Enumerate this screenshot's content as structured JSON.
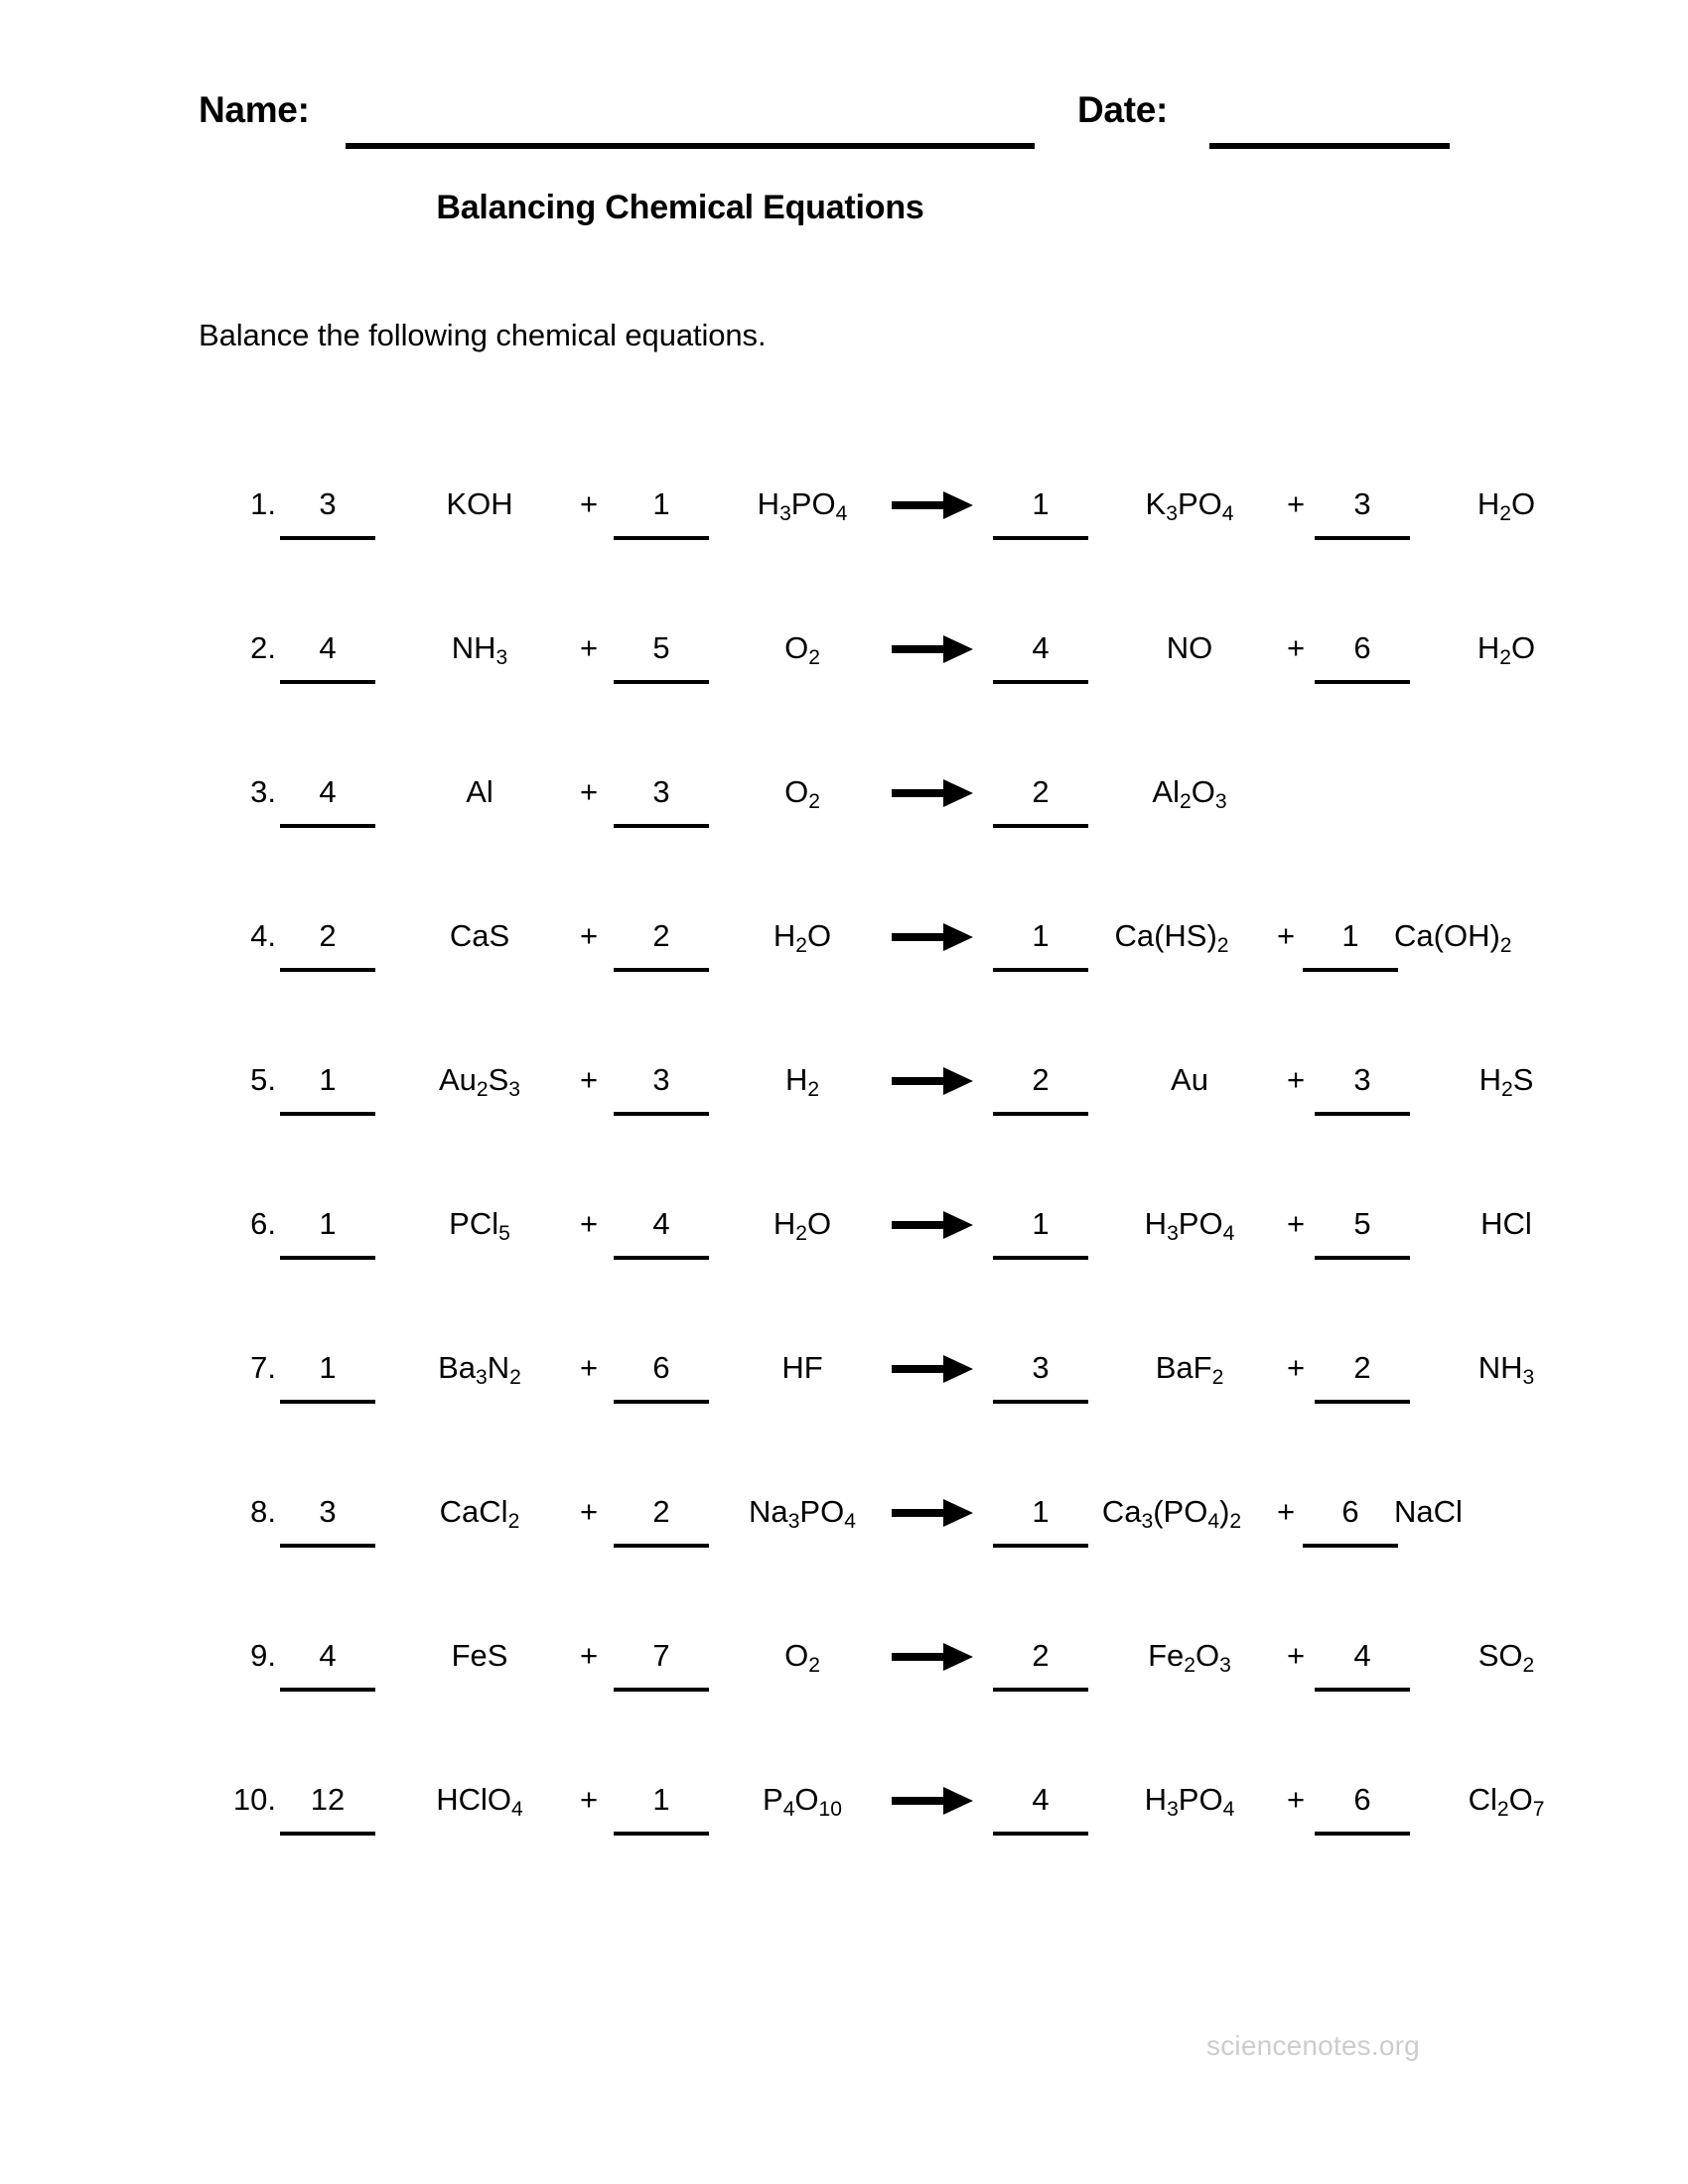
{
  "header": {
    "name_label": "Name:",
    "date_label": "Date:"
  },
  "title": "Balancing Chemical Equations",
  "instructions": "Balance the following chemical equations.",
  "footer": {
    "site": "sciencenotes.org"
  },
  "symbols": {
    "plus": "+",
    "arrow": "arrow-right-icon"
  },
  "colors": {
    "text": "#000000",
    "rule": "#000000",
    "footer": "#cdcdcd",
    "background": "#ffffff"
  },
  "equations": [
    {
      "number": "1.",
      "coef1": "3",
      "formula1": "KOH",
      "plus1": "+",
      "coef2": "1",
      "formula2": "H<sub>3</sub>PO<sub>4</sub>",
      "coef3": "1",
      "formula3": "K<sub>3</sub>PO<sub>4</sub>",
      "plus2": "+",
      "coef4": "3",
      "formula4": "H<sub>2</sub>O",
      "wide": false
    },
    {
      "number": "2.",
      "coef1": "4",
      "formula1": "NH<sub>3</sub>",
      "plus1": "+",
      "coef2": "5",
      "formula2": "O<sub>2</sub>",
      "coef3": "4",
      "formula3": "NO",
      "plus2": "+",
      "coef4": "6",
      "formula4": "H<sub>2</sub>O",
      "wide": false
    },
    {
      "number": "3.",
      "coef1": "4",
      "formula1": "Al",
      "plus1": "+",
      "coef2": "3",
      "formula2": "O<sub>2</sub>",
      "coef3": "2",
      "formula3": "Al<sub>2</sub>O<sub>3</sub>",
      "plus2": "",
      "coef4": "",
      "formula4": "",
      "wide": false
    },
    {
      "number": "4.",
      "coef1": "2",
      "formula1": "CaS",
      "plus1": "+",
      "coef2": "2",
      "formula2": "H<sub>2</sub>O",
      "coef3": "1",
      "formula3": "Ca(HS)<sub>2</sub>",
      "plus2": "+",
      "coef4": "1",
      "formula4": "Ca(OH)<sub>2</sub>",
      "wide": true
    },
    {
      "number": "5.",
      "coef1": "1",
      "formula1": "Au<sub>2</sub>S<sub>3</sub>",
      "plus1": "+",
      "coef2": "3",
      "formula2": "H<sub>2</sub>",
      "coef3": "2",
      "formula3": "Au",
      "plus2": "+",
      "coef4": "3",
      "formula4": "H<sub>2</sub>S",
      "wide": false
    },
    {
      "number": "6.",
      "coef1": "1",
      "formula1": "PCl<sub>5</sub>",
      "plus1": "+",
      "coef2": "4",
      "formula2": "H<sub>2</sub>O",
      "coef3": "1",
      "formula3": "H<sub>3</sub>PO<sub>4</sub>",
      "plus2": "+",
      "coef4": "5",
      "formula4": "HCl",
      "wide": false
    },
    {
      "number": "7.",
      "coef1": "1",
      "formula1": "Ba<sub>3</sub>N<sub>2</sub>",
      "plus1": "+",
      "coef2": "6",
      "formula2": "HF",
      "coef3": "3",
      "formula3": "BaF<sub>2</sub>",
      "plus2": "+",
      "coef4": "2",
      "formula4": "NH<sub>3</sub>",
      "wide": false
    },
    {
      "number": "8.",
      "coef1": "3",
      "formula1": "CaCl<sub>2</sub>",
      "plus1": "+",
      "coef2": "2",
      "formula2": "Na<sub>3</sub>PO<sub>4</sub>",
      "coef3": "1",
      "formula3": "Ca<sub>3</sub>(PO<sub>4</sub>)<sub>2</sub>",
      "plus2": "+",
      "coef4": "6",
      "formula4": "NaCl",
      "wide": true
    },
    {
      "number": "9.",
      "coef1": "4",
      "formula1": "FeS",
      "plus1": "+",
      "coef2": "7",
      "formula2": "O<sub>2</sub>",
      "coef3": "2",
      "formula3": "Fe<sub>2</sub>O<sub>3</sub>",
      "plus2": "+",
      "coef4": "4",
      "formula4": "SO<sub>2</sub>",
      "wide": false
    },
    {
      "number": "10.",
      "coef1": "12",
      "formula1": "HClO<sub>4</sub>",
      "plus1": "+",
      "coef2": "1",
      "formula2": "P<sub>4</sub>O<sub>10</sub>",
      "coef3": "4",
      "formula3": "H<sub>3</sub>PO<sub>4</sub>",
      "plus2": "+",
      "coef4": "6",
      "formula4": "Cl<sub>2</sub>O<sub>7</sub>",
      "wide": false
    }
  ]
}
